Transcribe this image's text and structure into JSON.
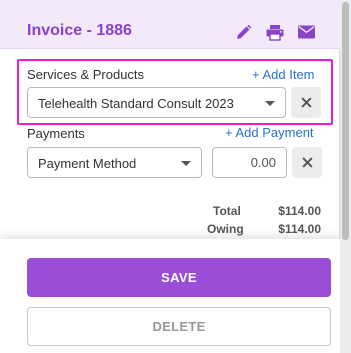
{
  "header": {
    "title": "Invoice - 1886",
    "icons": [
      "pencil-icon",
      "printer-icon",
      "envelope-icon"
    ],
    "accent": "#8a44c6",
    "background": "#f4e8fb"
  },
  "services": {
    "label": "Services & Products",
    "add_label": "+ Add Item",
    "selected_item": "Telehealth Standard Consult 2023",
    "highlight_color": "#e91ad8"
  },
  "payments": {
    "label": "Payments",
    "add_label": "+ Add Payment",
    "method_placeholder": "Payment Method",
    "amount_value": "0.00"
  },
  "totals": {
    "total_label": "Total",
    "total_value": "$114.00",
    "owing_label": "Owing",
    "owing_value": "$114.00"
  },
  "actions": {
    "save_label": "SAVE",
    "delete_label": "DELETE",
    "save_color": "#9a4ed8"
  },
  "link_color": "#2a73c9"
}
